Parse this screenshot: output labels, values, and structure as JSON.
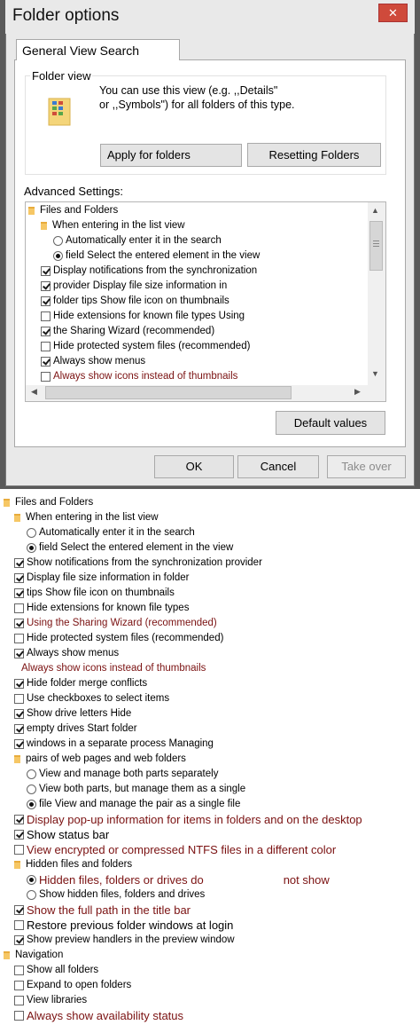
{
  "dialog": {
    "title": "Folder options",
    "close_glyph": "✕",
    "tab_label": "General View Search",
    "folder_view": {
      "label": "Folder view",
      "desc_line1": "You can use this view (e.g. ,,Details\"",
      "desc_line2": "or ,,Symbols\") for all folders of this type.",
      "apply_label": "Apply for folders",
      "reset_label": "Resetting Folders"
    },
    "advanced_label": "Advanced Settings:",
    "default_label": "Default values",
    "ok_label": "OK",
    "cancel_label": "Cancel",
    "takeover_label": "Take over",
    "tree": [
      {
        "type": "folder",
        "label": "Files and Folders"
      },
      {
        "type": "folder",
        "label": "When entering in the list view"
      },
      {
        "type": "radio",
        "checked": false,
        "label": "Automatically enter it in the search"
      },
      {
        "type": "radio",
        "checked": true,
        "label": "field Select the entered element in the view"
      },
      {
        "type": "check",
        "checked": true,
        "label": "Display notifications from the synchronization"
      },
      {
        "type": "check",
        "checked": true,
        "label": "provider Display file size information in"
      },
      {
        "type": "check",
        "checked": true,
        "label": "folder tips Show file icon on thumbnails"
      },
      {
        "type": "check",
        "checked": false,
        "label": "Hide extensions for known file types Using"
      },
      {
        "type": "check",
        "checked": true,
        "label": "the Sharing Wizard (recommended)"
      },
      {
        "type": "check",
        "checked": false,
        "label": "Hide protected system files (recommended)"
      },
      {
        "type": "check",
        "checked": true,
        "label": "Always show menus"
      },
      {
        "type": "check",
        "checked": false,
        "label": "Always show icons instead of thumbnails",
        "red": true
      }
    ]
  },
  "expanded_tree": [
    {
      "type": "folder",
      "label": "Files and Folders"
    },
    {
      "type": "folder",
      "label": "When entering in the list view"
    },
    {
      "type": "radio",
      "checked": false,
      "label": "Automatically enter it in the search"
    },
    {
      "type": "radio",
      "checked": true,
      "label": "field Select the entered element in the view"
    },
    {
      "type": "check",
      "checked": true,
      "label": "Show notifications from the synchronization provider"
    },
    {
      "type": "check",
      "checked": true,
      "label": "Display file size information in folder"
    },
    {
      "type": "check",
      "checked": true,
      "label": "tips Show file icon on thumbnails"
    },
    {
      "type": "check",
      "checked": false,
      "label": "Hide extensions for known file types"
    },
    {
      "type": "check",
      "checked": true,
      "label": "Using the Sharing Wizard (recommended)",
      "red": true
    },
    {
      "type": "check",
      "checked": false,
      "label": "Hide protected system files (recommended)"
    },
    {
      "type": "check",
      "checked": true,
      "label": "Always show menus"
    },
    {
      "type": "none",
      "label": "Always show icons instead of thumbnails",
      "red": true
    },
    {
      "type": "check",
      "checked": true,
      "label": "Hide folder merge conflicts"
    },
    {
      "type": "check",
      "checked": false,
      "label": "Use checkboxes to select items"
    },
    {
      "type": "check",
      "checked": true,
      "label": "Show drive letters Hide"
    },
    {
      "type": "check",
      "checked": true,
      "label": "empty drives Start folder"
    },
    {
      "type": "check",
      "checked": true,
      "label": "windows in a separate process Managing"
    },
    {
      "type": "folder",
      "label": "pairs of web pages and web folders"
    },
    {
      "type": "radio",
      "checked": false,
      "label": "View and manage both parts separately"
    },
    {
      "type": "radio",
      "checked": false,
      "label": "View both parts, but manage them as a single"
    },
    {
      "type": "radio",
      "checked": true,
      "label": "file View and manage the pair as a single file"
    },
    {
      "type": "check",
      "checked": true,
      "label": "Display pop-up information for items in folders and on the desktop",
      "red": true,
      "big": true
    },
    {
      "type": "check",
      "checked": true,
      "label": "Show status bar",
      "big": true
    },
    {
      "type": "check",
      "checked": false,
      "label": "View encrypted or compressed NTFS files in a different color",
      "red": true,
      "big": true
    },
    {
      "type": "folder",
      "label": "Hidden files and folders"
    },
    {
      "type": "radio",
      "checked": true,
      "label": "Hidden files, folders or drives do",
      "suffix": "not show",
      "red": true,
      "big": true
    },
    {
      "type": "radio",
      "checked": false,
      "label": "Show hidden files, folders and drives"
    },
    {
      "type": "check",
      "checked": true,
      "label": "Show the full path in the title bar",
      "red": true,
      "big": true
    },
    {
      "type": "check",
      "checked": false,
      "label": "Restore previous folder windows at login",
      "big": true
    },
    {
      "type": "check",
      "checked": true,
      "label": "Show preview handlers in the preview window"
    },
    {
      "type": "folder",
      "label": "Navigation"
    },
    {
      "type": "check",
      "checked": false,
      "label": "Show all folders"
    },
    {
      "type": "check",
      "checked": false,
      "label": "Expand to open folders"
    },
    {
      "type": "check",
      "checked": false,
      "label": "View libraries"
    },
    {
      "type": "check",
      "checked": false,
      "label": "Always show availability status",
      "red": true,
      "big": true
    }
  ]
}
